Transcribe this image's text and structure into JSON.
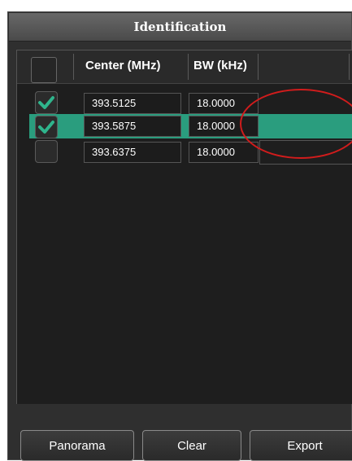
{
  "panel": {
    "title": "Identification"
  },
  "table": {
    "headers": {
      "center": "Center (MHz)",
      "bw": "BW (kHz)"
    },
    "rows": [
      {
        "checked": true,
        "selected": false,
        "center": "393.5125",
        "bw": "18.0000"
      },
      {
        "checked": true,
        "selected": true,
        "center": "393.5875",
        "bw": "18.0000"
      },
      {
        "checked": false,
        "selected": false,
        "center": "393.6375",
        "bw": "18.0000"
      }
    ]
  },
  "buttons": {
    "panorama": "Panorama",
    "clear": "Clear",
    "export": "Export"
  },
  "colors": {
    "selection": "#2a9d7e",
    "checkmark": "#2fb48c",
    "annotation": "#d11c1c"
  }
}
